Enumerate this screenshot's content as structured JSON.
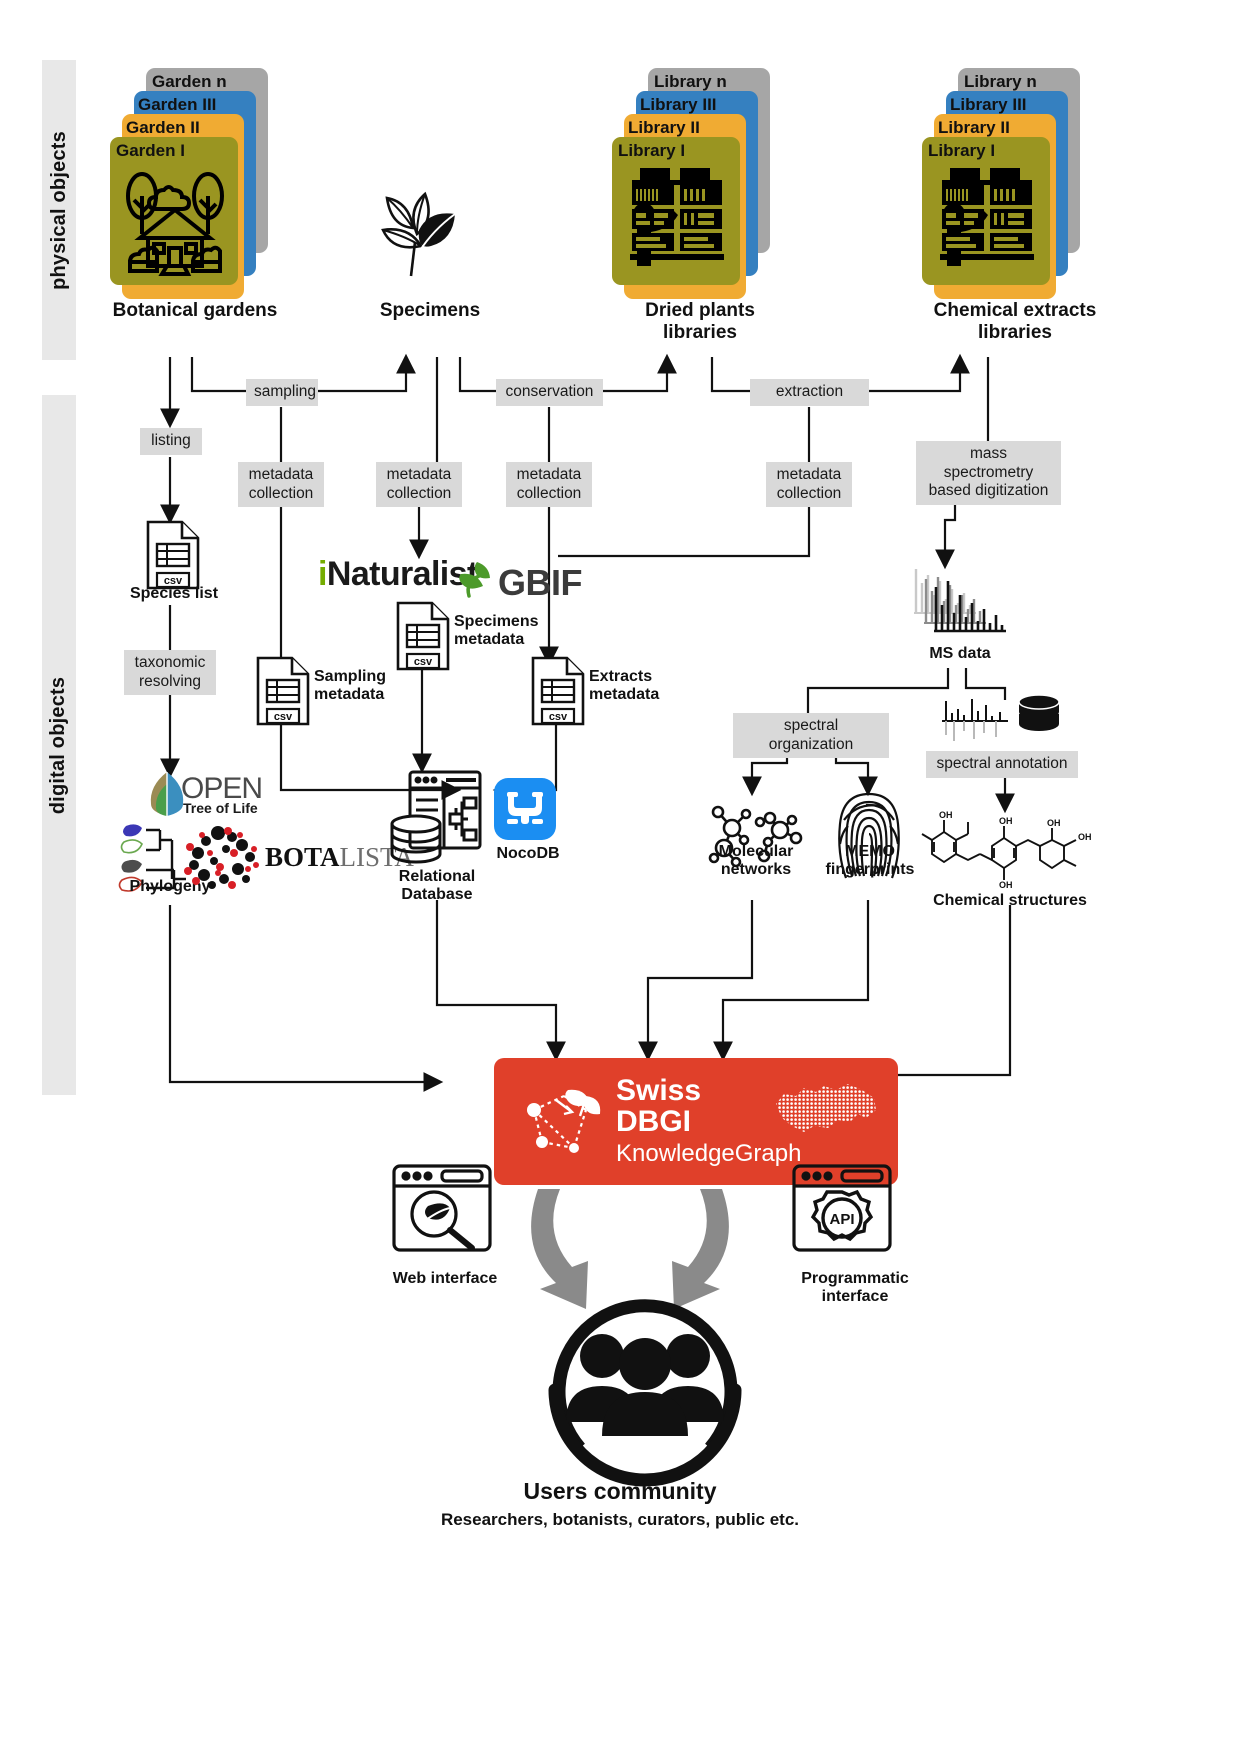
{
  "sections": [
    {
      "id": "physical",
      "label": "physical objects"
    },
    {
      "id": "digital",
      "label": "digital objects"
    }
  ],
  "colors": {
    "card_gray": "#a6a6a6",
    "card_blue": "#3580c0",
    "card_orange": "#f0ab33",
    "card_olive": "#9a9521",
    "process_bg": "#d9d9d9",
    "rail_bg": "#e8e8e8",
    "dbgi_red": "#e0402a",
    "arrow_gray": "#8a8a8a",
    "inaturalist_green": "#74ac00",
    "gbif_green": "#4c9a2a",
    "nocodb_blue": "#1b8ef2",
    "botalista_red": "#d81f26"
  },
  "physical_groups": [
    {
      "name": "botanical-gardens",
      "title": "Botanical gardens",
      "cards": [
        "Garden n",
        "Garden III",
        "Garden II",
        "Garden I"
      ],
      "icon": "garden-icon"
    },
    {
      "name": "specimens",
      "title": "Specimens",
      "cards": [],
      "icon": "leaves-icon"
    },
    {
      "name": "dried-plants-libraries",
      "title": "Dried plants\nlibraries",
      "cards": [
        "Library n",
        "Library III",
        "Library II",
        "Library I"
      ],
      "icon": "library-icon"
    },
    {
      "name": "chemical-extracts-libraries",
      "title": "Chemical extracts\nlibraries",
      "cards": [
        "Library n",
        "Library III",
        "Library II",
        "Library I"
      ],
      "icon": "library-icon"
    }
  ],
  "processes": {
    "sampling": "sampling",
    "conservation": "conservation",
    "extraction": "extraction",
    "listing": "listing",
    "metadata_collection": "metadata\ncollection",
    "mass_spec": "mass spectrometry\nbased digitization",
    "taxonomic_resolving": "taxonomic\nresolving",
    "spectral_organization": "spectral organization",
    "spectral_annotation": "spectral annotation"
  },
  "digital_objects": {
    "species_list": "Species list",
    "sampling_metadata": "Sampling\nmetadata",
    "specimens_metadata": "Specimens\nmetadata",
    "extracts_metadata": "Extracts\nmetadata",
    "relational_database": "Relational\nDatabase",
    "phylogeny": "Phylogeny",
    "ms_data": "MS data",
    "molecular_networks": "Molecular\nnetworks",
    "memo_fingerprints": "MEMO\nfingerprints",
    "chemical_structures": "Chemical structures"
  },
  "logos": {
    "inaturalist": {
      "prefix": "i",
      "name": "Naturalist"
    },
    "gbif": "GBIF",
    "open_tree_of_life": {
      "line1": "OPEN",
      "line2": "Tree of Life"
    },
    "botalista": {
      "part1": "BO",
      "part2": "T",
      "part3": "A",
      "part4": "LISTA"
    },
    "nocodb": "NocoDB",
    "csv_badge": "csv"
  },
  "knowledge_graph": {
    "line1": "Swiss",
    "line2": "DBGI",
    "line3": "KnowledgeGraph"
  },
  "interfaces": {
    "web": "Web interface",
    "programmatic": "Programmatic\ninterface",
    "api_badge": "API"
  },
  "community": {
    "title": "Users community",
    "subtitle": "Researchers, botanists, curators, public etc."
  }
}
